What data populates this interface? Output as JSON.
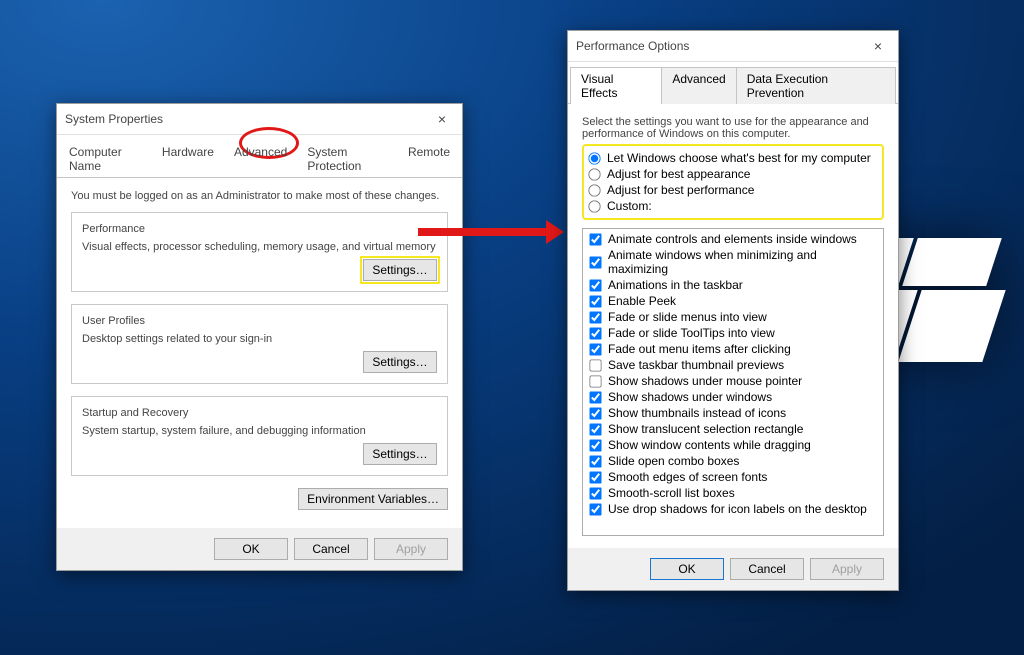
{
  "left": {
    "title": "System Properties",
    "tabs": [
      "Computer Name",
      "Hardware",
      "Advanced",
      "System Protection",
      "Remote"
    ],
    "active_tab": 2,
    "admin_note": "You must be logged on as an Administrator to make most of these changes.",
    "groups": {
      "performance": {
        "title": "Performance",
        "desc": "Visual effects, processor scheduling, memory usage, and virtual memory",
        "btn": "Settings…"
      },
      "userprofiles": {
        "title": "User Profiles",
        "desc": "Desktop settings related to your sign-in",
        "btn": "Settings…"
      },
      "startup": {
        "title": "Startup and Recovery",
        "desc": "System startup, system failure, and debugging information",
        "btn": "Settings…"
      }
    },
    "env_btn": "Environment Variables…",
    "ok": "OK",
    "cancel": "Cancel",
    "apply": "Apply"
  },
  "right": {
    "title": "Performance Options",
    "tabs": [
      "Visual Effects",
      "Advanced",
      "Data Execution Prevention"
    ],
    "active_tab": 0,
    "intro": "Select the settings you want to use for the appearance and performance of Windows on this computer.",
    "radios": [
      {
        "label": "Let Windows choose what's best for my computer",
        "checked": true
      },
      {
        "label": "Adjust for best appearance",
        "checked": false
      },
      {
        "label": "Adjust for best performance",
        "checked": false
      },
      {
        "label": "Custom:",
        "checked": false
      }
    ],
    "checks": [
      {
        "label": "Animate controls and elements inside windows",
        "checked": true
      },
      {
        "label": "Animate windows when minimizing and maximizing",
        "checked": true
      },
      {
        "label": "Animations in the taskbar",
        "checked": true
      },
      {
        "label": "Enable Peek",
        "checked": true
      },
      {
        "label": "Fade or slide menus into view",
        "checked": true
      },
      {
        "label": "Fade or slide ToolTips into view",
        "checked": true
      },
      {
        "label": "Fade out menu items after clicking",
        "checked": true
      },
      {
        "label": "Save taskbar thumbnail previews",
        "checked": false
      },
      {
        "label": "Show shadows under mouse pointer",
        "checked": false
      },
      {
        "label": "Show shadows under windows",
        "checked": true
      },
      {
        "label": "Show thumbnails instead of icons",
        "checked": true
      },
      {
        "label": "Show translucent selection rectangle",
        "checked": true
      },
      {
        "label": "Show window contents while dragging",
        "checked": true
      },
      {
        "label": "Slide open combo boxes",
        "checked": true
      },
      {
        "label": "Smooth edges of screen fonts",
        "checked": true
      },
      {
        "label": "Smooth-scroll list boxes",
        "checked": true
      },
      {
        "label": "Use drop shadows for icon labels on the desktop",
        "checked": true
      }
    ],
    "ok": "OK",
    "cancel": "Cancel",
    "apply": "Apply"
  }
}
